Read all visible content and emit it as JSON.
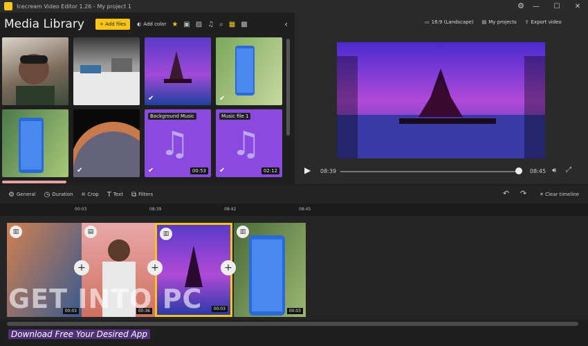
{
  "window": {
    "title": "Icecream Video Editor 1.26 - My project 1"
  },
  "library": {
    "title": "Media Library",
    "add_files": "+ Add files",
    "add_color": "Add color",
    "items": [
      {
        "label": "",
        "duration": ""
      },
      {
        "label": "",
        "duration": ""
      },
      {
        "label": "",
        "duration": ""
      },
      {
        "label": "",
        "duration": ""
      },
      {
        "label": "",
        "duration": ""
      },
      {
        "label": "",
        "duration": ""
      },
      {
        "label": "Background Music",
        "duration": "00:53"
      },
      {
        "label": "Music file 1",
        "duration": "02:12"
      }
    ]
  },
  "preview": {
    "aspect": "16:9 (Landscape)",
    "my_projects": "My projects",
    "export": "Export video",
    "current_time": "08:39",
    "total_time": "08:45",
    "progress": 0.97
  },
  "edit_toolbar": {
    "general": "General",
    "duration": "Duration",
    "crop": "Crop",
    "text": "Text",
    "filters": "Filters",
    "clear": "Clear timeline"
  },
  "timeline": {
    "ticks": [
      "00:03",
      "08:39",
      "08:42",
      "08:45"
    ],
    "clips": [
      {
        "duration": "00:03"
      },
      {
        "duration": "00:36"
      },
      {
        "duration": "00:03"
      },
      {
        "duration": "00:03"
      }
    ]
  },
  "watermark": {
    "main": "GET INTO PC",
    "sub": "Download Free Your Desired App"
  },
  "colors": {
    "accent": "#f5c518"
  }
}
